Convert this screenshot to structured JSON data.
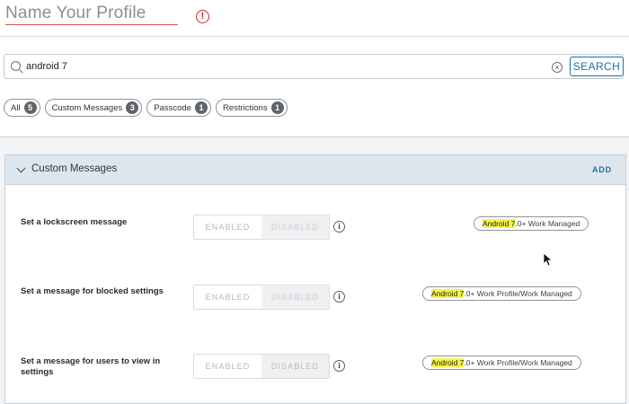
{
  "profile": {
    "name": "Name Your Profile"
  },
  "search": {
    "value": "android 7",
    "button_label": "SEARCH"
  },
  "filters": [
    {
      "label": "All",
      "count": "5"
    },
    {
      "label": "Custom Messages",
      "count": "3"
    },
    {
      "label": "Passcode",
      "count": "1"
    },
    {
      "label": "Restrictions",
      "count": "1"
    }
  ],
  "section": {
    "title": "Custom Messages",
    "add_label": "ADD",
    "rows": [
      {
        "label": "Set a lockscreen message",
        "toggle_on": "ENABLED",
        "toggle_off": "DISABLED",
        "badge_highlight": "Android 7",
        "badge_rest": ".0+ Work Managed"
      },
      {
        "label": "Set a message for blocked settings",
        "toggle_on": "ENABLED",
        "toggle_off": "DISABLED",
        "badge_highlight": "Android 7",
        "badge_rest": ".0+ Work Profile/Work Managed"
      },
      {
        "label": "Set a message for users to view in settings",
        "toggle_on": "ENABLED",
        "toggle_off": "DISABLED",
        "badge_highlight": "Android 7",
        "badge_rest": ".0+ Work Profile/Work Managed"
      }
    ]
  },
  "icons": {
    "error": "error-circle-icon",
    "search": "search-icon",
    "clear": "clear-circle-icon",
    "chevron": "chevron-down-icon",
    "info": "info-icon",
    "cursor": "mouse-cursor-icon"
  },
  "colors": {
    "accent": "#1f6fa6",
    "error": "#c62828",
    "highlight": "#f6f24a",
    "section_header": "#dde6ed"
  }
}
